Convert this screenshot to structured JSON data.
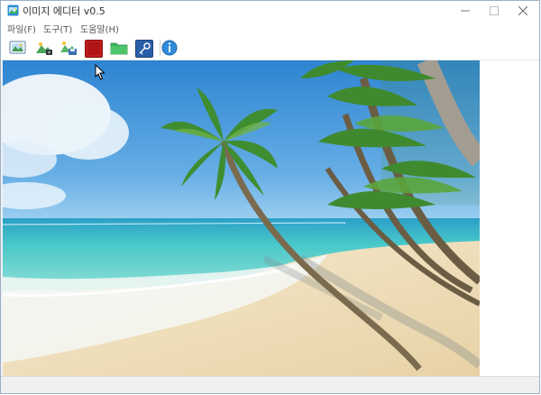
{
  "window": {
    "title": "이미지 에디터 v0.5"
  },
  "menu": {
    "file": "파일(F)",
    "tools": "도구(T)",
    "help": "도움말(H)"
  },
  "toolbar": {
    "buttons": [
      {
        "icon": "open-image-icon"
      },
      {
        "icon": "landscape-edit-icon"
      },
      {
        "icon": "save-image-icon"
      },
      {
        "icon": "red-square-icon"
      },
      {
        "icon": "folder-icon"
      },
      {
        "icon": "key-icon"
      },
      {
        "icon": "info-icon"
      }
    ]
  },
  "colors": {
    "accent": "#2d7fc4",
    "sky": "#3e8fd4",
    "sea": "#5fd3cb",
    "sand": "#efe0bf"
  }
}
